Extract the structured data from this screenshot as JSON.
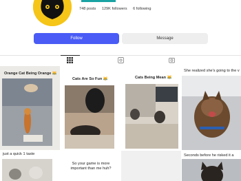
{
  "profile": {
    "posts": "748 posts",
    "followers": "129K followers",
    "following": "6 following"
  },
  "actions": {
    "follow": "Follow",
    "message": "Message"
  },
  "tabs": [
    {
      "icon": "grid-icon",
      "active": true
    },
    {
      "icon": "reels-icon",
      "active": false
    },
    {
      "icon": "tagged-icon",
      "active": false
    }
  ],
  "grid": [
    {
      "caption": "Orange Cat Being Orange 😹"
    },
    {
      "caption": "Cats Are So Fun 😹"
    },
    {
      "caption": "Cats Being Mean 😹"
    },
    {
      "caption": "She realized she's going to the v"
    },
    {
      "caption": "just a quick 1 taste"
    },
    {
      "caption": "So your game is more important than me huh?"
    },
    {
      "caption": ""
    },
    {
      "caption": "Seconds before he risked it a"
    }
  ]
}
